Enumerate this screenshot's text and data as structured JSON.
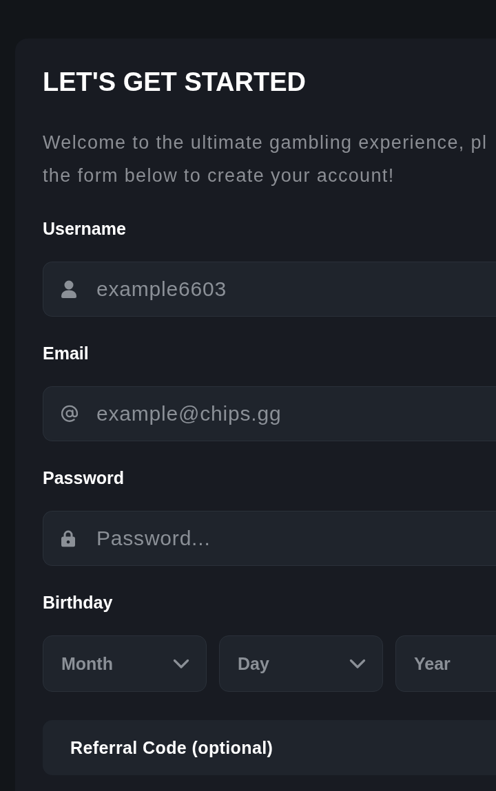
{
  "title": "LET'S GET STARTED",
  "intro": [
    "Welcome to the ultimate gambling experience, pl",
    "the form below to create your account!"
  ],
  "fields": [
    {
      "kind": "user",
      "label": "Username",
      "placeholder": "example6603"
    },
    {
      "kind": "email",
      "label": "Email",
      "placeholder": "example@chips.gg"
    },
    {
      "kind": "password",
      "label": "Password",
      "placeholder": "Password..."
    }
  ],
  "birthday": {
    "label": "Birthday",
    "parts": [
      {
        "kind": "dropdown",
        "placeholder": "Month"
      },
      {
        "kind": "dropdown",
        "placeholder": "Day"
      },
      {
        "kind": "text",
        "placeholder": "Year"
      }
    ]
  },
  "referral": {
    "label": "Referral Code (optional)"
  }
}
